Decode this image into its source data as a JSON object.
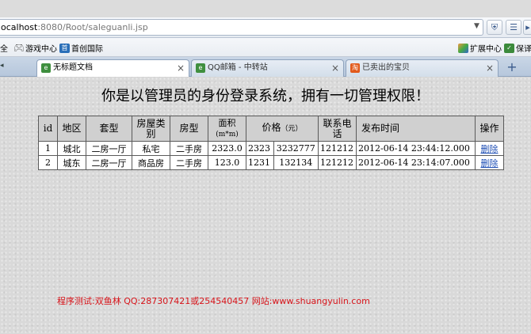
{
  "browser": {
    "address": {
      "host": "ocalhost",
      "path": ":8080/Root/saleguanli.jsp"
    },
    "bookmarks": [
      {
        "label": "全",
        "icon": ""
      },
      {
        "label": "游戏中心",
        "icon": "gamepad-icon"
      },
      {
        "label": "首创国际",
        "icon": "site-icon"
      },
      {
        "label": "扩展中心",
        "icon": "extension-icon"
      },
      {
        "label": "保译",
        "icon": "translate-icon"
      }
    ],
    "tabs": [
      {
        "label": "无标题文档",
        "active": true,
        "close": "×"
      },
      {
        "label": "QQ邮箱 - 中转站",
        "active": false,
        "close": "×"
      },
      {
        "label": "已卖出的宝贝",
        "active": false,
        "close": "×"
      }
    ],
    "new_tab": "+"
  },
  "page": {
    "title": "你是以管理员的身份登录系统，拥有一切管理权限！",
    "table": {
      "headers": [
        "id",
        "地区",
        "套型",
        "房屋类别",
        "房型",
        "面积（m*m）",
        "价格（元）",
        "联系电话",
        "发布时间",
        "操作"
      ],
      "header_lines": {
        "house_cat": [
          "房屋类",
          "别"
        ],
        "area": [
          "面积",
          "(m*m)"
        ],
        "price": [
          "价格",
          "（元）"
        ],
        "phone": [
          "联系电",
          "话"
        ]
      },
      "rows": [
        {
          "id": "1",
          "region": "城北",
          "layout": "二房一厅",
          "category": "私宅",
          "type": "二手房",
          "area": "2323.0",
          "price_a": "2323",
          "price_b": "3232777",
          "phone": "121212",
          "time": "2012-06-14 23:44:12.000",
          "action": "删除"
        },
        {
          "id": "2",
          "region": "城东",
          "layout": "二房一厅",
          "category": "商品房",
          "type": "二手房",
          "area": "123.0",
          "price_a": "1231",
          "price_b": "132134",
          "phone": "121212",
          "time": "2012-06-14 23:14:07.000",
          "action": "删除"
        }
      ]
    },
    "footer": "程序测试:双鱼林 QQ:287307421或254540457 网站:www.shuangyulin.com"
  },
  "colors": {
    "footer": "#d8141a",
    "link": "#1f4fb5"
  }
}
